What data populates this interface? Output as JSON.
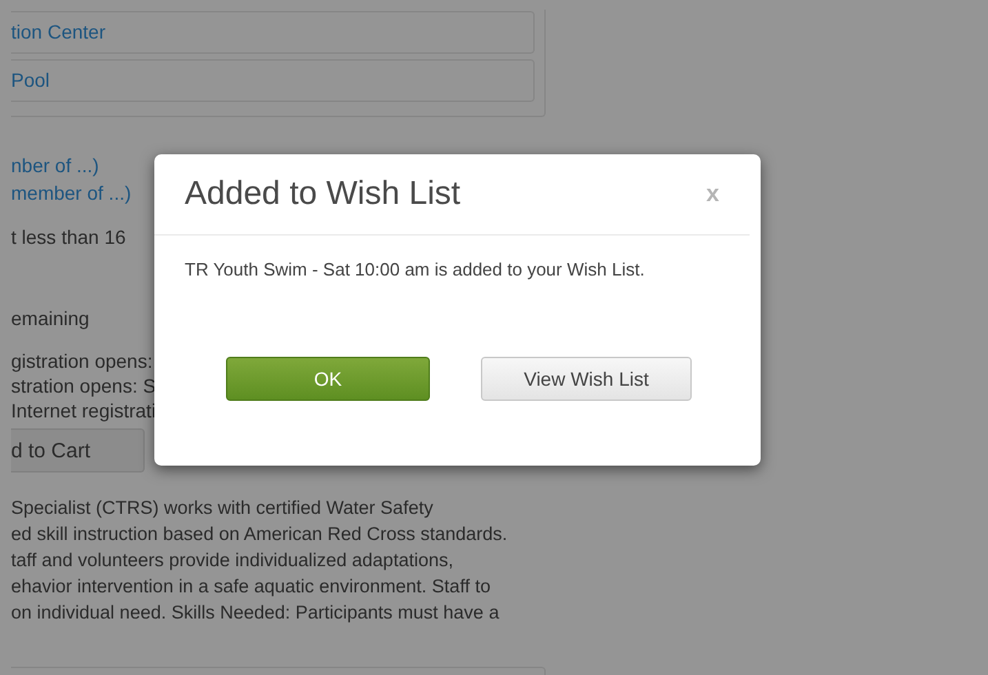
{
  "locations": [
    "tion Center",
    "Pool"
  ],
  "links": [
    "nber of ...)",
    "member of ...)"
  ],
  "age_note": "t less than 16",
  "remaining": "emaining",
  "registration_lines": [
    "gistration opens:",
    "stration opens: S",
    "Internet registrati"
  ],
  "add_to_cart": "d to Cart",
  "description_lines": [
    "Specialist (CTRS) works with certified Water Safety",
    "ed skill instruction based on American Red Cross standards.",
    "taff and volunteers provide individualized adaptations,",
    "ehavior intervention in a safe aquatic environment. Staff to",
    "on individual need. Skills Needed: Participants must have a"
  ],
  "dialog": {
    "title": "Added to Wish List",
    "close": "x",
    "message": "TR Youth Swim - Sat 10:00 am is added to your Wish List.",
    "buttons": [
      {
        "label": "OK",
        "kind": "primary"
      },
      {
        "label": "View Wish List",
        "kind": "secondary"
      }
    ]
  }
}
